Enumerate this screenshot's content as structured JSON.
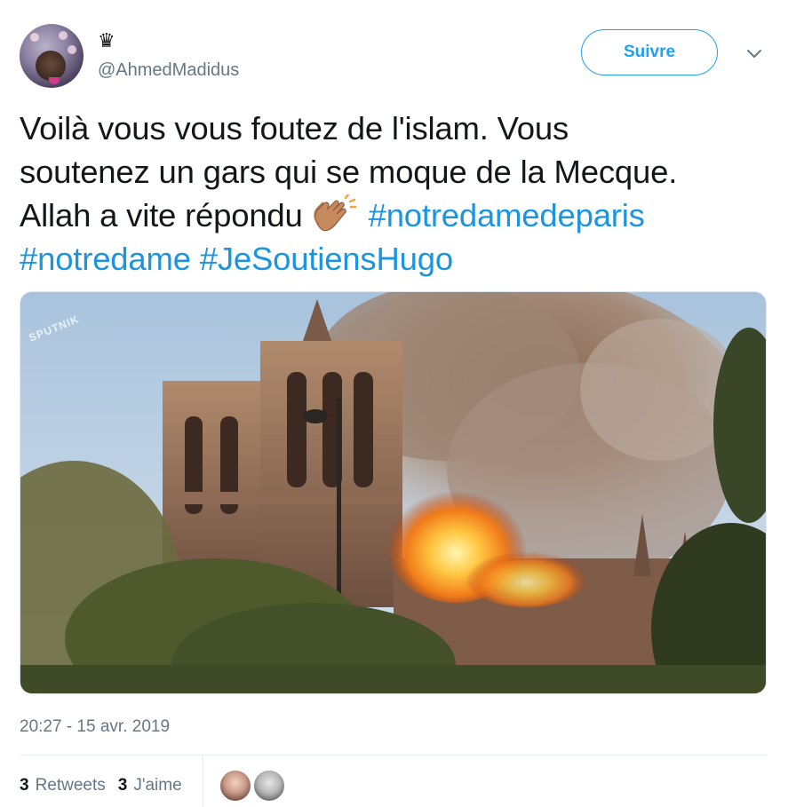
{
  "header": {
    "crown_glyph": "♛",
    "handle": "@AhmedMadidus",
    "follow_label": "Suivre",
    "avatar_icon": "user-avatar",
    "more_icon": "chevron-down-icon"
  },
  "tweet": {
    "line1": "Voilà vous vous foutez de l'islam. Vous",
    "line2": "soutenez un gars qui se moque de la Mecque.",
    "line3_text": "Allah a vite répondu",
    "emoji_icon": "clapping-hands-icon",
    "hashtags": [
      "#notredamedeparis",
      "#notredame",
      "#JeSoutiensHugo"
    ]
  },
  "media": {
    "watermark": "SPUTNIK"
  },
  "footer": {
    "timestamp": "20:27 - 15 avr. 2019",
    "retweets_count": "3",
    "retweets_label": "Retweets",
    "likes_count": "3",
    "likes_label": "J'aime"
  },
  "colors": {
    "accent": "#1da1f2",
    "hashtag": "#1b95e0",
    "secondary_text": "#657786"
  }
}
